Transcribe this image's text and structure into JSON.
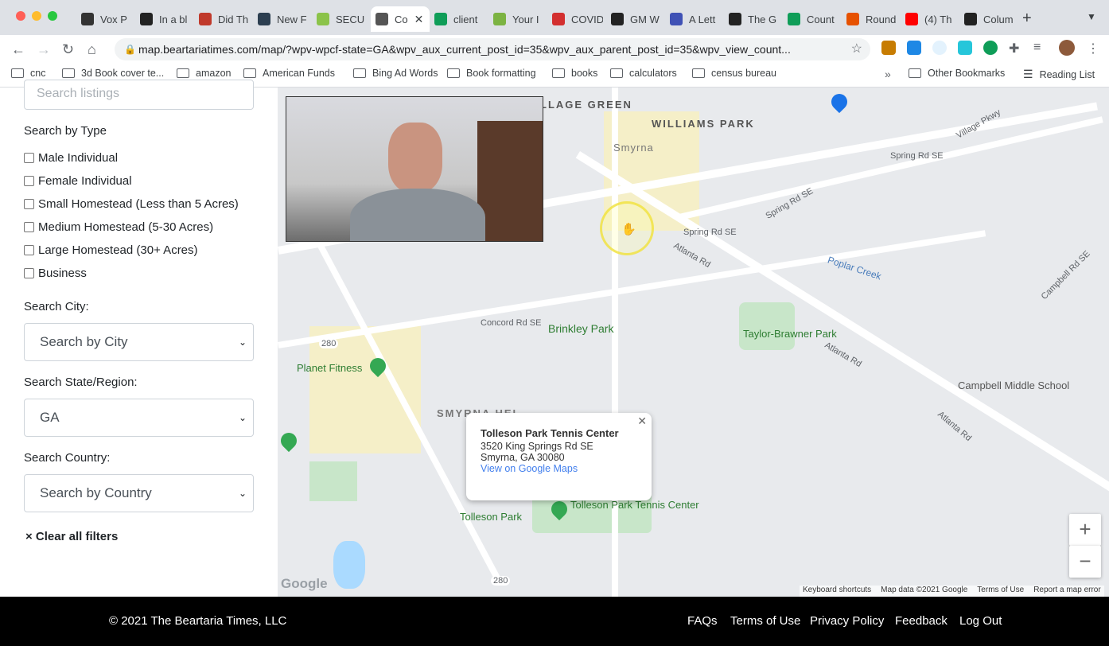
{
  "browser": {
    "tabs": [
      {
        "label": "Vox P",
        "color": "#333333"
      },
      {
        "label": "In a bl",
        "color": "#222222"
      },
      {
        "label": "Did Th",
        "color": "#c0392b"
      },
      {
        "label": "New F",
        "color": "#2c3e50"
      },
      {
        "label": "SECU",
        "color": "#8bc34a"
      },
      {
        "label": "Co",
        "color": "#555555",
        "active": true
      },
      {
        "label": "client",
        "color": "#0f9d58"
      },
      {
        "label": "Your I",
        "color": "#7cb342"
      },
      {
        "label": "COVID",
        "color": "#d32f2f"
      },
      {
        "label": "GM W",
        "color": "#222222"
      },
      {
        "label": "A Lett",
        "color": "#3f51b5"
      },
      {
        "label": "The G",
        "color": "#222222"
      },
      {
        "label": "Count",
        "color": "#0f9d58"
      },
      {
        "label": "Round",
        "color": "#e65100"
      },
      {
        "label": "(4) Th",
        "color": "#ff0000"
      },
      {
        "label": "Colum",
        "color": "#222222"
      }
    ],
    "url": "map.beartariatimes.com/map/?wpv-wpcf-state=GA&wpv_aux_current_post_id=35&wpv_aux_parent_post_id=35&wpv_view_count...",
    "bookmarks": [
      "cnc",
      "3d Book cover te...",
      "amazon",
      "American Funds",
      "Bing Ad Words",
      "Book formatting",
      "books",
      "calculators",
      "census bureau"
    ],
    "other_bookmarks": "Other Bookmarks",
    "reading_list": "Reading List"
  },
  "filters": {
    "search_placeholder": "Search listings",
    "type_heading": "Search by Type",
    "types": [
      "Male Individual",
      "Female Individual",
      "Small Homestead (Less than 5 Acres)",
      "Medium Homestead (5-30 Acres)",
      "Large Homestead (30+ Acres)",
      "Business"
    ],
    "city_heading": "Search City:",
    "city_value": "Search by City",
    "state_heading": "Search State/Region:",
    "state_value": "GA",
    "country_heading": "Search Country:",
    "country_value": "Search by Country",
    "clear": "× Clear all filters"
  },
  "map": {
    "labels": {
      "village_green": "LLAGE GREEN",
      "williams_park": "WILLIAMS PARK",
      "smyrna": "Smyrna",
      "spring_rd_se_1": "Spring Rd SE",
      "spring_rd_se_2": "Spring Rd SE",
      "spring_rd_se_3": "Spring Rd SE",
      "atlanta_rd_1": "Atlanta Rd",
      "atlanta_rd_2": "Atlanta Rd",
      "atlanta_rd_3": "Atlanta Rd",
      "poplar_creek": "Poplar Creek",
      "brinkley_park": "Brinkley Park",
      "taylor_brawner": "Taylor-Brawner Park",
      "planet_fitness": "Planet Fitness",
      "campbell_ms": "Campbell Middle School",
      "smyrna_heights": "SMYRNA HEI",
      "concord_rd": "Concord Rd SE",
      "tolleson_park": "Tolleson Park",
      "tolleson_tennis": "Tolleson Park Tennis Center",
      "route_280_a": "280",
      "route_280_b": "280",
      "campbell_rd": "Campbell Rd SE",
      "village_pkwy": "Village Pkwy"
    },
    "popup": {
      "name": "Tolleson Park Tennis Center",
      "address1": "3520 King Springs Rd SE",
      "address2": "Smyrna, GA 30080",
      "link": "View on Google Maps"
    },
    "attribution": {
      "keyboard": "Keyboard shortcuts",
      "data": "Map data ©2021 Google",
      "terms": "Terms of Use",
      "report": "Report a map error",
      "google": "Google"
    },
    "zoom_in": "+",
    "zoom_out": "−"
  },
  "footer": {
    "copyright": "© 2021 The Beartaria Times, LLC",
    "links": [
      "FAQs",
      "Terms of Use",
      "Privacy Policy",
      "Feedback",
      "Log Out"
    ]
  }
}
